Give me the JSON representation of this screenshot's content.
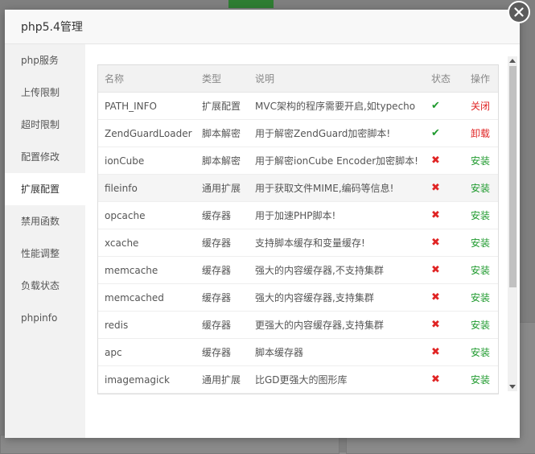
{
  "modal": {
    "title": "php5.4管理"
  },
  "sidebar": {
    "items": [
      {
        "label": "php服务"
      },
      {
        "label": "上传限制"
      },
      {
        "label": "超时限制"
      },
      {
        "label": "配置修改"
      },
      {
        "label": "扩展配置"
      },
      {
        "label": "禁用函数"
      },
      {
        "label": "性能调整"
      },
      {
        "label": "负载状态"
      },
      {
        "label": "phpinfo"
      }
    ],
    "active": "扩展配置"
  },
  "table": {
    "headers": [
      "名称",
      "类型",
      "说明",
      "状态",
      "操作"
    ],
    "rows": [
      {
        "name": "PATH_INFO",
        "type": "扩展配置",
        "desc": "MVC架构的程序需要开启,如typecho",
        "status": "✔",
        "status_state": "enabled",
        "op": "关闭"
      },
      {
        "name": "ZendGuardLoader",
        "type": "脚本解密",
        "desc": "用于解密ZendGuard加密脚本!",
        "status": "✔",
        "status_state": "enabled",
        "op": "卸载"
      },
      {
        "name": "ionCube",
        "type": "脚本解密",
        "desc": "用于解密ionCube Encoder加密脚本!",
        "status": "✖",
        "status_state": "disabled",
        "op": "安装"
      },
      {
        "name": "fileinfo",
        "type": "通用扩展",
        "desc": "用于获取文件MIME,编码等信息!",
        "status": "✖",
        "status_state": "disabled",
        "op": "安装"
      },
      {
        "name": "opcache",
        "type": "缓存器",
        "desc": "用于加速PHP脚本!",
        "status": "✖",
        "status_state": "disabled",
        "op": "安装"
      },
      {
        "name": "xcache",
        "type": "缓存器",
        "desc": "支持脚本缓存和变量缓存!",
        "status": "✖",
        "status_state": "disabled",
        "op": "安装"
      },
      {
        "name": "memcache",
        "type": "缓存器",
        "desc": "强大的内容缓存器,不支持集群",
        "status": "✖",
        "status_state": "disabled",
        "op": "安装"
      },
      {
        "name": "memcached",
        "type": "缓存器",
        "desc": "强大的内容缓存器,支持集群",
        "status": "✖",
        "status_state": "disabled",
        "op": "安装"
      },
      {
        "name": "redis",
        "type": "缓存器",
        "desc": "更强大的内容缓存器,支持集群",
        "status": "✖",
        "status_state": "disabled",
        "op": "安装"
      },
      {
        "name": "apc",
        "type": "缓存器",
        "desc": "脚本缓存器",
        "status": "✖",
        "status_state": "disabled",
        "op": "安装"
      },
      {
        "name": "imagemagick",
        "type": "通用扩展",
        "desc": "比GD更强大的图形库",
        "status": "✖",
        "status_state": "disabled",
        "op": "安装"
      }
    ],
    "highlighted_row": 3
  },
  "colors": {
    "enabled": "#1f9a2e",
    "disabled": "#e02424",
    "close_button_bg": "#5c5c5c"
  },
  "icons": {
    "close": "close-icon",
    "enabled": "check-icon",
    "disabled": "cross-icon"
  }
}
